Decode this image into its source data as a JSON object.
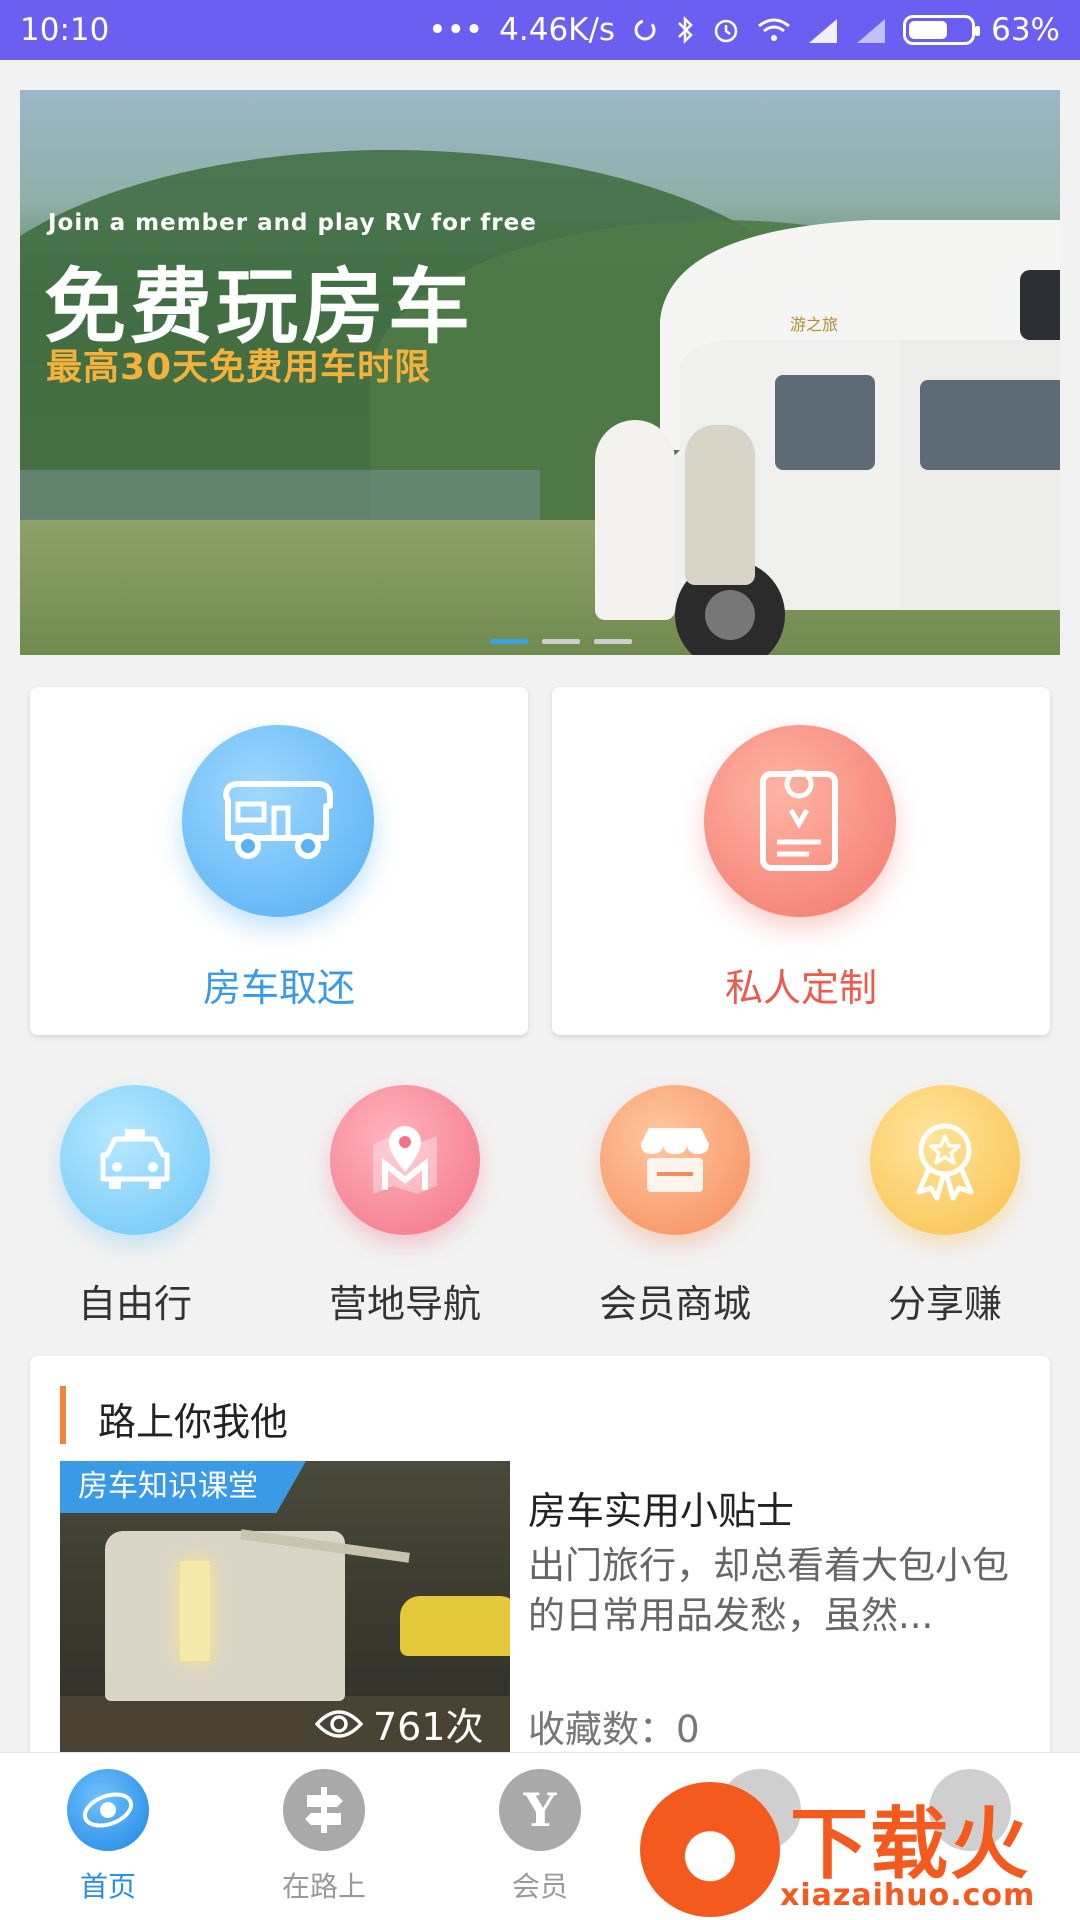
{
  "status_bar": {
    "time": "10:10",
    "speed": "4.46K/s",
    "battery": "63%",
    "battery_level": 0.63,
    "icons": [
      "more-dots-icon",
      "sync-icon",
      "bluetooth-icon",
      "alarm-icon",
      "wifi-icon",
      "signal-icon",
      "signal-icon",
      "battery-icon"
    ]
  },
  "banner": {
    "english_line": "Join a member and play RV for free",
    "headline": "免费玩房车",
    "subline": "最高30天免费用车时限",
    "slide_count": 3,
    "active_slide": 1,
    "colors": {
      "subline": "#f4b13c",
      "active_dot": "#3aa0e8"
    }
  },
  "big_cards": [
    {
      "label": "房车取还",
      "icon": "rv-icon",
      "color": "#3a9ae6"
    },
    {
      "label": "私人定制",
      "icon": "map-book-icon",
      "color": "#ee5b4c"
    }
  ],
  "quick_actions": [
    {
      "label": "自由行",
      "icon": "car-icon"
    },
    {
      "label": "营地导航",
      "icon": "map-pin-icon"
    },
    {
      "label": "会员商城",
      "icon": "store-icon"
    },
    {
      "label": "分享赚",
      "icon": "award-icon"
    }
  ],
  "section": {
    "title": "路上你我他",
    "article": {
      "tag": "房车知识课堂",
      "views": "761次",
      "title": "房车实用小贴士",
      "description": "出门旅行，却总看着大包小包的日常用品发愁，虽然...",
      "favorites": "收藏数：0"
    }
  },
  "tab_bar": {
    "active": "首页",
    "tabs": [
      {
        "label": "首页",
        "icon": "home-logo-icon"
      },
      {
        "label": "在路上",
        "icon": "signpost-icon"
      },
      {
        "label": "会员",
        "icon": "member-y-icon"
      },
      {
        "label": "",
        "icon": "clipboard-icon"
      },
      {
        "label": "",
        "icon": "profile-icon"
      }
    ]
  },
  "watermark": {
    "text": "下载火",
    "url": "xiazaihuo.com"
  }
}
